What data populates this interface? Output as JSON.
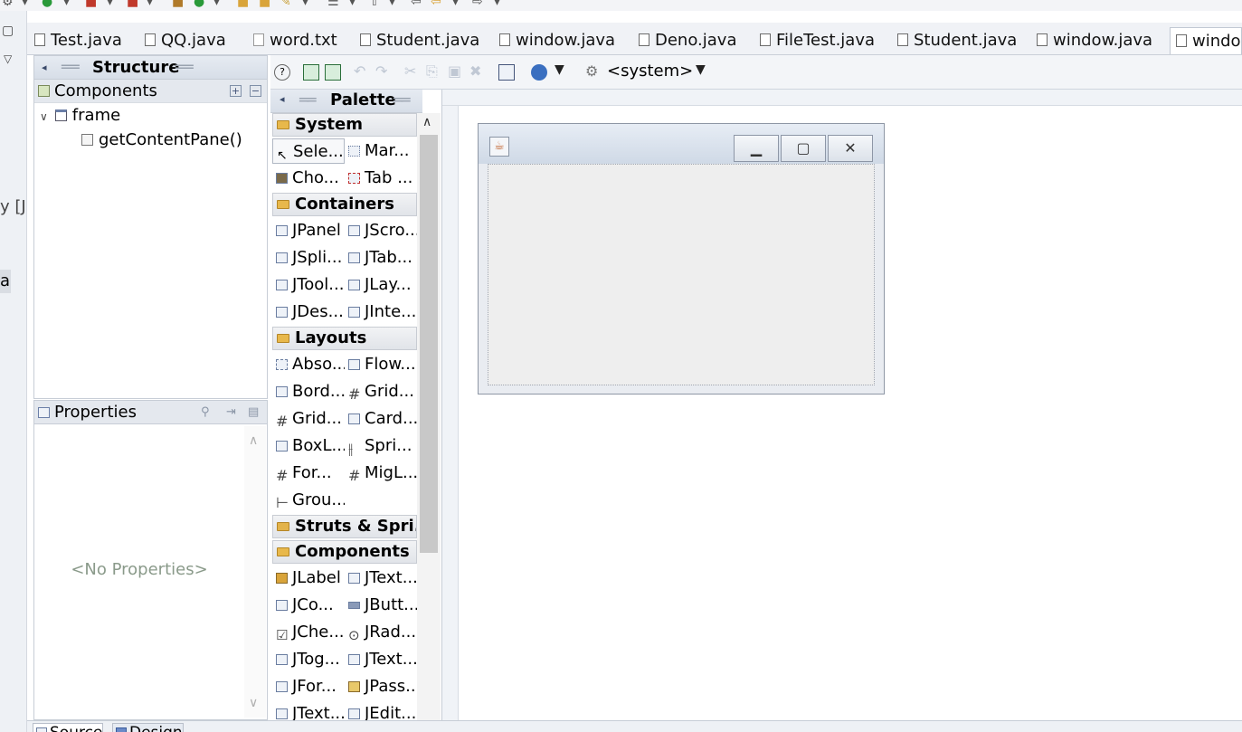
{
  "editor_tabs": [
    {
      "label": "Test.java"
    },
    {
      "label": "QQ.java"
    },
    {
      "label": "word.txt"
    },
    {
      "label": "Student.java"
    },
    {
      "label": "window.java"
    },
    {
      "label": "Deno.java"
    },
    {
      "label": "FileTest.java"
    },
    {
      "label": "Student.java"
    },
    {
      "label": "window.java"
    },
    {
      "label": "windo"
    }
  ],
  "left_strip": {
    "text_a": "y [J",
    "text_b": "a"
  },
  "structure": {
    "title": "Structure",
    "components_label": "Components",
    "tree": [
      {
        "label": "frame"
      },
      {
        "label": "getContentPane()"
      }
    ]
  },
  "properties": {
    "title": "Properties",
    "empty_text": "<No Properties>"
  },
  "design_toolbar": {
    "system_label": "<system>"
  },
  "palette": {
    "title": "Palette",
    "categories": {
      "system": "System",
      "containers": "Containers",
      "layouts": "Layouts",
      "struts": "Struts & Spri...",
      "components": "Components"
    },
    "system_items": [
      "Sele...",
      "Mar...",
      "Cho...",
      "Tab ..."
    ],
    "container_items": [
      "JPanel",
      "JScro...",
      "JSpli...",
      "JTab...",
      "JTool...",
      "JLay...",
      "JDes...",
      "JInte..."
    ],
    "layout_items": [
      "Abso...",
      "Flow...",
      "Bord...",
      "Grid...",
      "Grid...",
      "Card...",
      "BoxL...",
      "Spri...",
      "For...",
      "MigL...",
      "Grou..."
    ],
    "component_items": [
      "JLabel",
      "JText...",
      "JCo...",
      "JButt...",
      "JChe...",
      "JRad...",
      "JTog...",
      "JText...",
      "JFor...",
      "JPass...",
      "JText...",
      "JEdit..."
    ]
  },
  "bottom_tabs": {
    "source": "Source",
    "design": "Design"
  }
}
